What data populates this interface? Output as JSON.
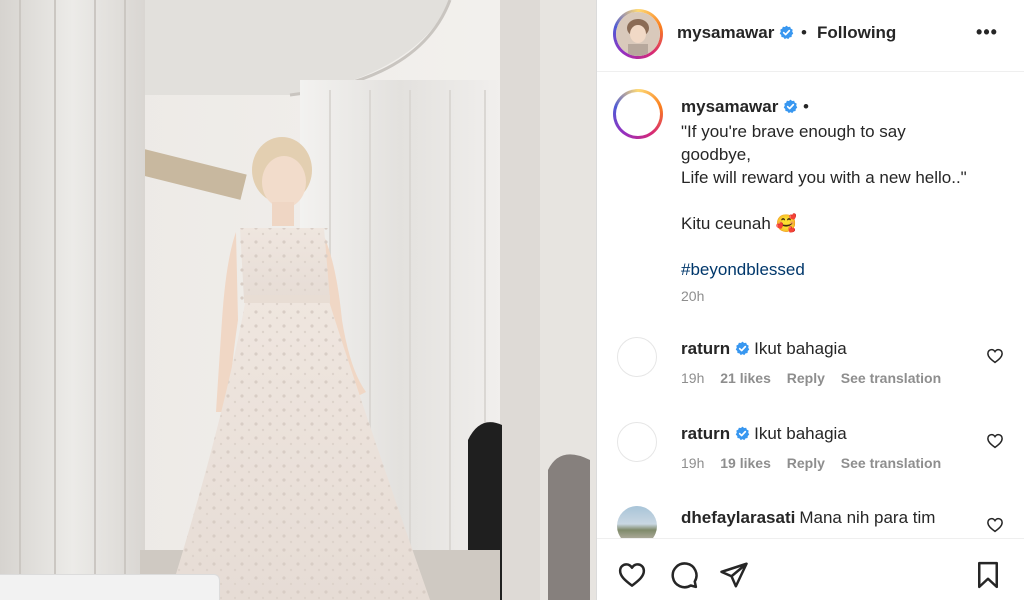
{
  "post": {
    "author": "mysamawar",
    "follow_status": "Following",
    "separator": "•",
    "more_label": "•••",
    "caption_lines": [
      "\"If you're brave enough to say",
      "goodbye,",
      "Life will reward you with a new hello..\""
    ],
    "caption_line2": "Kitu ceunah",
    "caption_emoji": "🥰",
    "hashtag": "#beyondblessed",
    "time": "20h"
  },
  "comments": [
    {
      "user": "raturn",
      "text": "Ikut bahagia",
      "time": "19h",
      "likes": "21 likes",
      "reply": "Reply",
      "translate": "See translation"
    },
    {
      "user": "raturn",
      "text": "Ikut bahagia",
      "time": "19h",
      "likes": "19 likes",
      "reply": "Reply",
      "translate": "See translation"
    },
    {
      "user": "dhefaylarasati",
      "text": "Mana nih para tim"
    }
  ],
  "icons": {
    "verified": "verified-badge-icon",
    "more": "more-options-icon",
    "like": "heart-icon",
    "comment": "comment-bubble-icon",
    "share": "paper-plane-icon",
    "save": "bookmark-icon"
  },
  "colors": {
    "verified": "#3897f0",
    "hashtag": "#00376b",
    "muted": "#8e8e8e",
    "text": "#262626"
  }
}
